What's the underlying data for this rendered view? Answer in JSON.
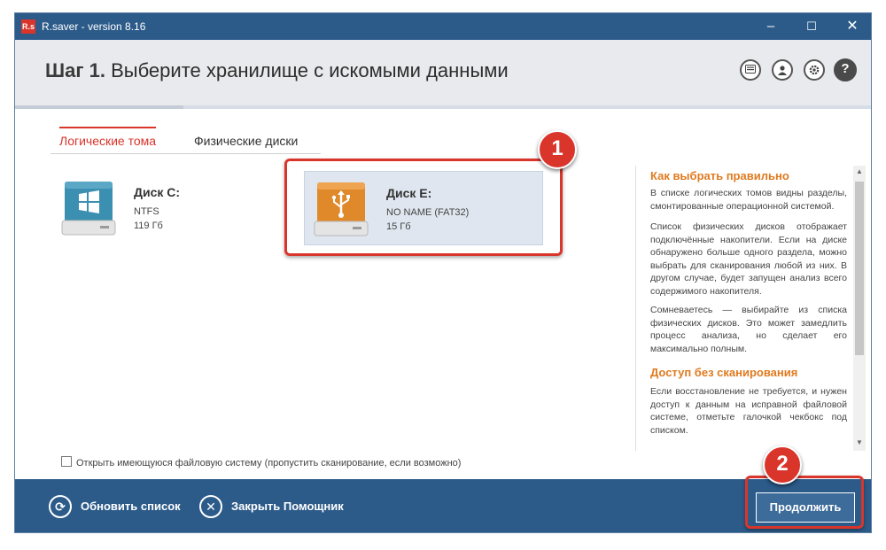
{
  "titlebar": {
    "logo": "R.s",
    "title": "R.saver - version 8.16",
    "minimize": "–",
    "maximize": "☐",
    "close": "✕"
  },
  "header": {
    "step": "Шаг 1.",
    "title": "Выберите хранилище с искомыми данными",
    "icons": [
      "keyboard-icon",
      "user-icon",
      "gear-icon",
      "help-icon"
    ],
    "help_glyph": "?"
  },
  "tabs": [
    {
      "label": "Логические тома",
      "active": true
    },
    {
      "label": "Физические диски",
      "active": false
    }
  ],
  "disks": [
    {
      "name": "Диск C:",
      "fs": "NTFS",
      "size": "119 Гб",
      "icon": "windows-drive-icon",
      "selected": false
    },
    {
      "name": "Диск E:",
      "fs": "NO NAME (FAT32)",
      "size": "15 Гб",
      "icon": "usb-drive-icon",
      "selected": true
    }
  ],
  "help": {
    "heading1": "Как выбрать правильно",
    "p1": "В списке логических томов видны разделы, смонтированные операционной системой.",
    "p2": "Список физических дисков отображает подключённые накопители. Если на диске обнаружено больше одного раздела, можно выбрать для сканирования любой из них. В другом случае, будет запущен анализ всего содержимого накопителя.",
    "p3": "Сомневаетесь — выбирайте из списка физических дисков. Это может замедлить процесс анализа, но сделает его максимально полным.",
    "heading2": "Доступ без сканирования",
    "p4": "Если восстановление не требуется, и нужен доступ к данным на исправной файловой системе, отметьте галочкой чекбокс под списком."
  },
  "checkbox": {
    "label": "Открыть имеющуюся файловую систему (пропустить сканирование, если возможно)",
    "checked": false
  },
  "footer": {
    "refresh_label": "Обновить список",
    "close_label": "Закрыть Помощник",
    "continue_label": "Продолжить"
  },
  "annotations": {
    "badge1": "1",
    "badge2": "2"
  },
  "colors": {
    "titlebar": "#2c5b8a",
    "accent_red": "#d9352b",
    "help_heading": "#e07a1f",
    "windows_drive": "#3b8fb0",
    "usb_drive": "#e0892a"
  }
}
